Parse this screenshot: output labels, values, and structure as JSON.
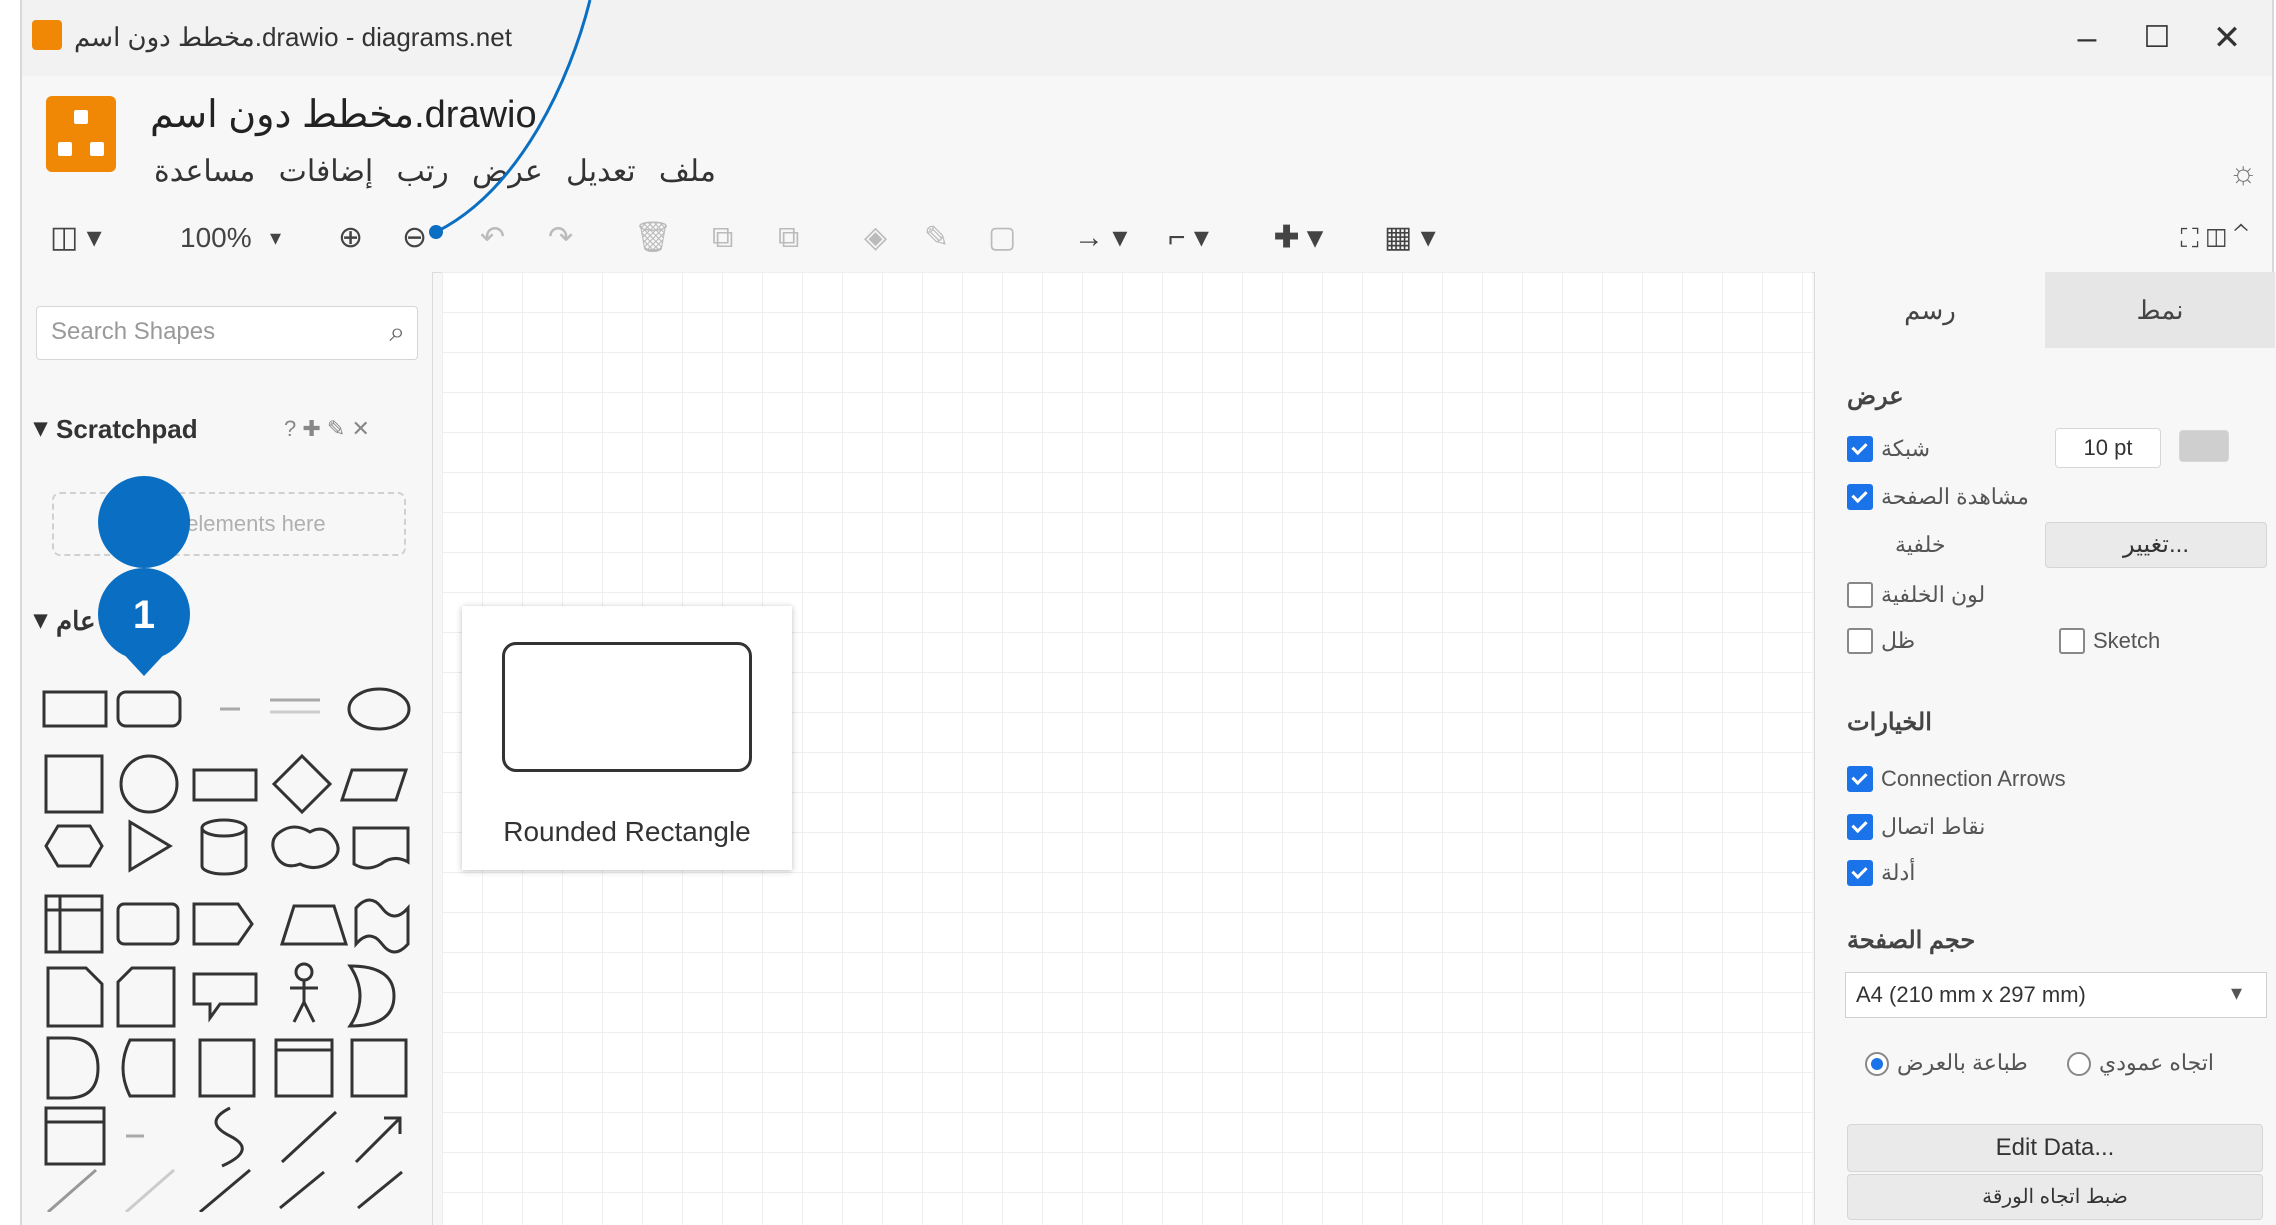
{
  "window": {
    "title": "مخطط دون اسم.drawio - diagrams.net",
    "controls": {
      "minimize": "–",
      "maximize": "☐",
      "close": "✕"
    }
  },
  "header": {
    "doc_title": "مخطط دون اسم.drawio",
    "menu": [
      "ملف",
      "تعديل",
      "عرض",
      "رتب",
      "إضافات",
      "مساعدة"
    ]
  },
  "toolbar": {
    "zoom": "100%"
  },
  "left_panel": {
    "search_placeholder": "Search Shapes",
    "scratchpad_title": "Scratchpad",
    "scratchpad_hint": "Drag elements here",
    "general_title": "عام",
    "badge_number": "1"
  },
  "canvas": {
    "preview_label": "Rounded Rectangle"
  },
  "right_panel": {
    "tabs": [
      "رسم",
      "نمط"
    ],
    "view_section": "عرض",
    "grid": "شبكة",
    "grid_size": "10 pt",
    "page_view": "مشاهدة الصفحة",
    "background": "خلفية",
    "change_button": "تغيير...",
    "background_color": "لون الخلفية",
    "shadow": "ظل",
    "sketch": "Sketch",
    "options_section": "الخيارات",
    "connection_arrows": "Connection Arrows",
    "connection_points": "نقاط اتصال",
    "guides": "أدلة",
    "paper_size_section": "حجم الصفحة",
    "paper_size_value": "A4 (210 mm x 297 mm)",
    "landscape": "اتجاه عمودي",
    "portrait": "طباعة بالعرض",
    "edit_data": "Edit Data...",
    "edit_style": "ضبط اتجاه الورقة"
  },
  "colors": {
    "accent": "#1a73e8",
    "callout": "#0a6fc2",
    "logo": "#f08705"
  }
}
